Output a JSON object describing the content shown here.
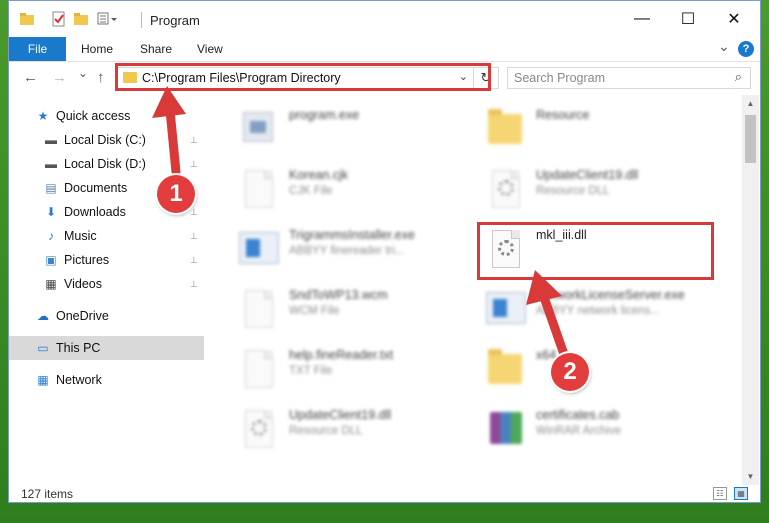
{
  "window": {
    "title": "Program",
    "controls": {
      "minimize": "—",
      "maximize": "☐",
      "close": "✕"
    }
  },
  "ribbon": {
    "tabs": [
      "File",
      "Home",
      "Share",
      "View"
    ],
    "help": "?",
    "expand_chevron": "⌄"
  },
  "navigation": {
    "back": "←",
    "forward": "→",
    "recent": "⌄",
    "up": "↑",
    "address": "C:\\Program Files\\Program Directory",
    "address_dropdown": "⌄",
    "refresh": "↻",
    "search_placeholder": "Search Program",
    "search_glyph": "⌕"
  },
  "sidebar": {
    "pin_glyph": "📌",
    "items": [
      {
        "label": "Quick access",
        "icon": "star-icon",
        "glyph": "★",
        "color": "#2b7bd6",
        "pinned": false,
        "selected": false
      },
      {
        "label": "Local Disk (C:)",
        "icon": "drive-icon",
        "glyph": "▬",
        "color": "#555555",
        "pinned": true,
        "selected": false
      },
      {
        "label": "Local Disk (D:)",
        "icon": "drive-icon",
        "glyph": "▬",
        "color": "#555555",
        "pinned": true,
        "selected": false
      },
      {
        "label": "Documents",
        "icon": "documents-icon",
        "glyph": "▤",
        "color": "#5a7fa8",
        "pinned": true,
        "selected": false
      },
      {
        "label": "Downloads",
        "icon": "downloads-icon",
        "glyph": "⬇",
        "color": "#2b7bd6",
        "pinned": true,
        "selected": false
      },
      {
        "label": "Music",
        "icon": "music-icon",
        "glyph": "♪",
        "color": "#2b7bd6",
        "pinned": true,
        "selected": false
      },
      {
        "label": "Pictures",
        "icon": "pictures-icon",
        "glyph": "▣",
        "color": "#3b86c6",
        "pinned": true,
        "selected": false
      },
      {
        "label": "Videos",
        "icon": "videos-icon",
        "glyph": "▦",
        "color": "#444444",
        "pinned": true,
        "selected": false
      },
      {
        "label": "OneDrive",
        "icon": "onedrive-icon",
        "glyph": "☁",
        "color": "#1f6fc6",
        "pinned": false,
        "selected": false
      },
      {
        "label": "This PC",
        "icon": "computer-icon",
        "glyph": "▭",
        "color": "#2b7bd6",
        "pinned": false,
        "selected": true
      },
      {
        "label": "Network",
        "icon": "network-icon",
        "glyph": "▦",
        "color": "#2b7bd6",
        "pinned": false,
        "selected": false
      }
    ]
  },
  "files": [
    {
      "name": "program.exe",
      "type": "",
      "icon": "program-exe-icon",
      "kind": "exe",
      "blurred": true
    },
    {
      "name": "Resource",
      "type": "",
      "icon": "folder-icon",
      "kind": "folder",
      "blurred": true
    },
    {
      "name": "Korean.cjk",
      "type": "CJK File",
      "icon": "file-icon",
      "kind": "doc",
      "blurred": true
    },
    {
      "name": "UpdateClient19.dll",
      "type": "Resource DLL",
      "icon": "dll-icon",
      "kind": "dll",
      "blurred": true
    },
    {
      "name": "TrigrammsInstaller.exe",
      "type": "ABBYY finereader tri...",
      "icon": "installer-icon",
      "kind": "app",
      "blurred": true
    },
    {
      "name": "mkl_iii.dll",
      "type": "",
      "icon": "dll-icon",
      "kind": "dll",
      "blurred": false
    },
    {
      "name": "SndToWP13.wcm",
      "type": "WCM File",
      "icon": "file-icon",
      "kind": "doc",
      "blurred": true
    },
    {
      "name": "NetworkLicenseServer.exe",
      "type": "ABBYY network licens...",
      "icon": "app-icon",
      "kind": "app",
      "blurred": true
    },
    {
      "name": "help.fineReader.txt",
      "type": "TXT File",
      "icon": "file-icon",
      "kind": "doc",
      "blurred": true
    },
    {
      "name": "x64",
      "type": "",
      "icon": "folder-icon",
      "kind": "folder",
      "blurred": true
    },
    {
      "name": "UpdateClient19.dll",
      "type": "Resource DLL",
      "icon": "dll-icon",
      "kind": "dll",
      "blurred": true
    },
    {
      "name": "certificates.cab",
      "type": "WinRAR Archive",
      "icon": "winrar-icon",
      "kind": "rar",
      "blurred": true
    }
  ],
  "status": {
    "item_count": "127 items",
    "details_view_glyph": "☷",
    "icons_view_glyph": "▦"
  },
  "annotations": {
    "step1": "1",
    "step2": "2",
    "highlight_color": "#d83a3a"
  }
}
